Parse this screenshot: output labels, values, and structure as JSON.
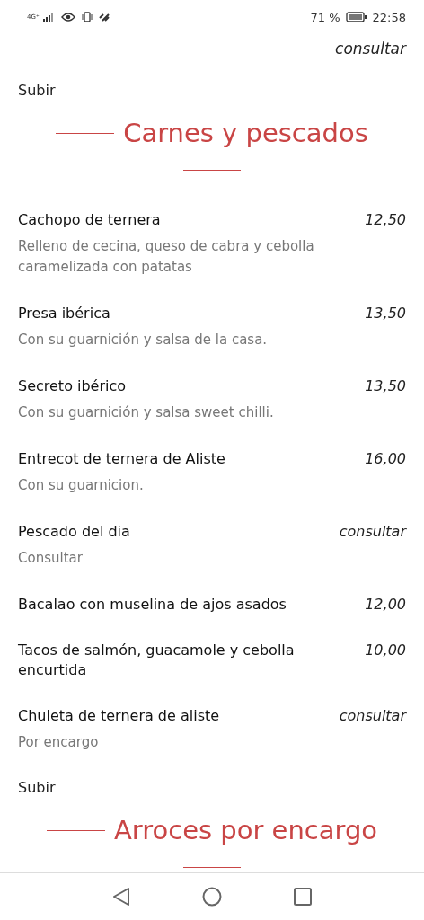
{
  "status_bar": {
    "network": "4G⁺",
    "battery_percent": "71 %",
    "time": "22:58"
  },
  "blocks": [
    {
      "kind": "price_only",
      "price": "consultar"
    },
    {
      "kind": "link",
      "label": "Subir"
    },
    {
      "kind": "heading",
      "title": "Carnes y pescados"
    },
    {
      "kind": "item",
      "name": "Cachopo de ternera",
      "price": "12,50",
      "description": "Relleno de cecina, queso de cabra y cebolla caramelizada con patatas"
    },
    {
      "kind": "item",
      "name": "Presa ibérica",
      "price": "13,50",
      "description": "Con su guarnición y salsa de la casa."
    },
    {
      "kind": "item",
      "name": "Secreto ibérico",
      "price": "13,50",
      "description": "Con su guarnición y salsa sweet chilli."
    },
    {
      "kind": "item",
      "name": "Entrecot de ternera de Aliste",
      "price": "16,00",
      "description": "Con su guarnicion."
    },
    {
      "kind": "item",
      "name": "Pescado del dia",
      "price": "consultar",
      "description": "Consultar"
    },
    {
      "kind": "item",
      "name": "Bacalao con muselina de ajos asados",
      "price": "12,00"
    },
    {
      "kind": "item",
      "name": "Tacos de salmón, guacamole y cebolla encurtida",
      "price": "10,00"
    },
    {
      "kind": "item",
      "name": "Chuleta de ternera de aliste",
      "price": "consultar",
      "description": "Por encargo"
    },
    {
      "kind": "link",
      "label": "Subir"
    },
    {
      "kind": "heading",
      "title": "Arroces por encargo"
    }
  ]
}
